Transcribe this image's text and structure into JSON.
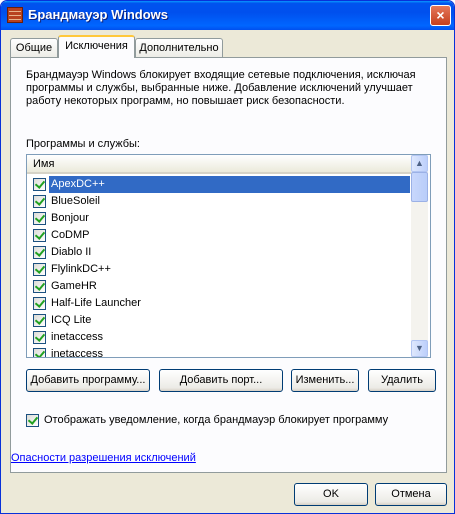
{
  "window": {
    "title": "Брандмауэр Windows",
    "close_glyph": "×"
  },
  "tabs": [
    {
      "label": "Общие"
    },
    {
      "label": "Исключения"
    },
    {
      "label": "Дополнительно"
    }
  ],
  "active_tab": "Исключения",
  "exceptions": {
    "description": "Брандмауэр Windows блокирует входящие сетевые подключения, исключая программы и службы, выбранные ниже. Добавление исключений улучшает работу некоторых программ, но повышает риск безопасности.",
    "list_label": "Программы и службы:",
    "column_header": "Имя",
    "items": [
      {
        "label": "ApexDC++",
        "checked": true,
        "selected": true
      },
      {
        "label": "BlueSoleil",
        "checked": true
      },
      {
        "label": "Bonjour",
        "checked": true
      },
      {
        "label": "CoDMP",
        "checked": true
      },
      {
        "label": "Diablo II",
        "checked": true
      },
      {
        "label": "FlylinkDC++",
        "checked": true
      },
      {
        "label": "GameHR",
        "checked": true
      },
      {
        "label": "Half-Life Launcher",
        "checked": true
      },
      {
        "label": "ICQ Lite",
        "checked": true
      },
      {
        "label": "inetaccess",
        "checked": true
      },
      {
        "label": "inetaccess",
        "checked": true
      }
    ],
    "buttons": {
      "add_program": "Добавить программу...",
      "add_port": "Добавить порт...",
      "edit": "Изменить...",
      "delete": "Удалить"
    },
    "notify_checkbox": {
      "label": "Отображать уведомление, когда брандмауэр блокирует программу",
      "checked": true
    },
    "risk_link": "Опасности разрешения исключений"
  },
  "dialog_buttons": {
    "ok": "OK",
    "cancel": "Отмена"
  },
  "scroll": {
    "up_glyph": "▲",
    "down_glyph": "▼"
  }
}
